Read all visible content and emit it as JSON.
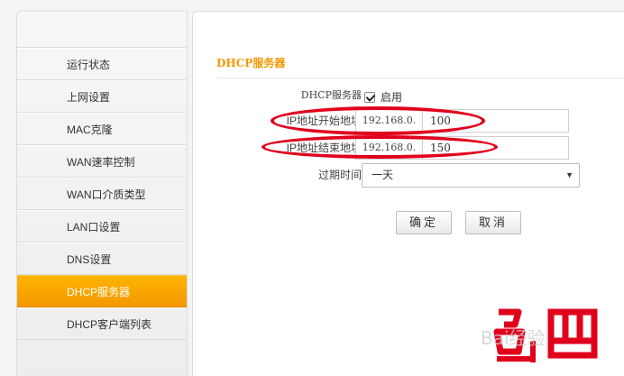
{
  "sidebar": {
    "items": [
      {
        "label": "运行状态",
        "active": false
      },
      {
        "label": "上网设置",
        "active": false
      },
      {
        "label": "MAC克隆",
        "active": false
      },
      {
        "label": "WAN速率控制",
        "active": false
      },
      {
        "label": "WAN口介质类型",
        "active": false
      },
      {
        "label": "LAN口设置",
        "active": false
      },
      {
        "label": "DNS设置",
        "active": false
      },
      {
        "label": "DHCP服务器",
        "active": true
      },
      {
        "label": "DHCP客户端列表",
        "active": false
      }
    ]
  },
  "main": {
    "title": "DHCP服务器",
    "dhcp": {
      "label": "DHCP服务器",
      "enable_label": "启用",
      "enabled": true
    },
    "start_ip": {
      "label": "IP地址开始地址",
      "prefix": "192.168.0.",
      "value": "100"
    },
    "end_ip": {
      "label": "IP地址结束地址",
      "prefix": "192.168.0.",
      "value": "150"
    },
    "lease": {
      "label": "过期时间",
      "value": "一天"
    },
    "buttons": {
      "confirm": "确定",
      "cancel": "取消"
    }
  },
  "colors": {
    "accent": "#f39800",
    "annotation": "#e0001b"
  },
  "watermark": {
    "text": "Bai经验"
  }
}
